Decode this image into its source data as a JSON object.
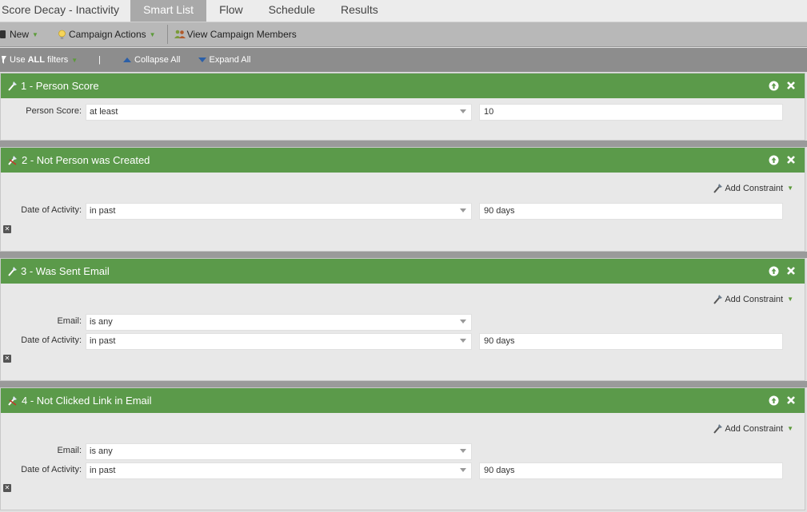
{
  "tabs": {
    "title": "Score Decay - Inactivity",
    "items": [
      {
        "label": "Smart List",
        "active": true
      },
      {
        "label": "Flow"
      },
      {
        "label": "Schedule"
      },
      {
        "label": "Results"
      }
    ]
  },
  "toolbar": {
    "new_label": "New",
    "campaign_actions_label": "Campaign Actions",
    "view_members_label": "View Campaign Members"
  },
  "filterbar": {
    "use_label": "Use",
    "all_label": "ALL",
    "filters_label": "filters",
    "pipe": "|",
    "collapse_label": "Collapse All",
    "expand_label": "Expand All"
  },
  "filters": [
    {
      "title": "1 - Person Score",
      "rows": [
        {
          "label": "Person Score:",
          "operator": "at least",
          "value": "10"
        }
      ]
    },
    {
      "title": "2 - Not Person was Created",
      "add_constraint": "Add Constraint",
      "rows": [
        {
          "label": "Date of Activity:",
          "operator": "in past",
          "value": "90 days"
        }
      ]
    },
    {
      "title": "3 - Was Sent Email",
      "add_constraint": "Add Constraint",
      "rows": [
        {
          "label": "Email:",
          "operator": "is any"
        },
        {
          "label": "Date of Activity:",
          "operator": "in past",
          "value": "90 days"
        }
      ]
    },
    {
      "title": "4 - Not Clicked Link in Email",
      "add_constraint": "Add Constraint",
      "rows": [
        {
          "label": "Email:",
          "operator": "is any"
        },
        {
          "label": "Date of Activity:",
          "operator": "in past",
          "value": "90 days"
        }
      ]
    }
  ],
  "colors": {
    "header_green": "#5b9a4a",
    "caret_green": "#5c9b3a"
  }
}
